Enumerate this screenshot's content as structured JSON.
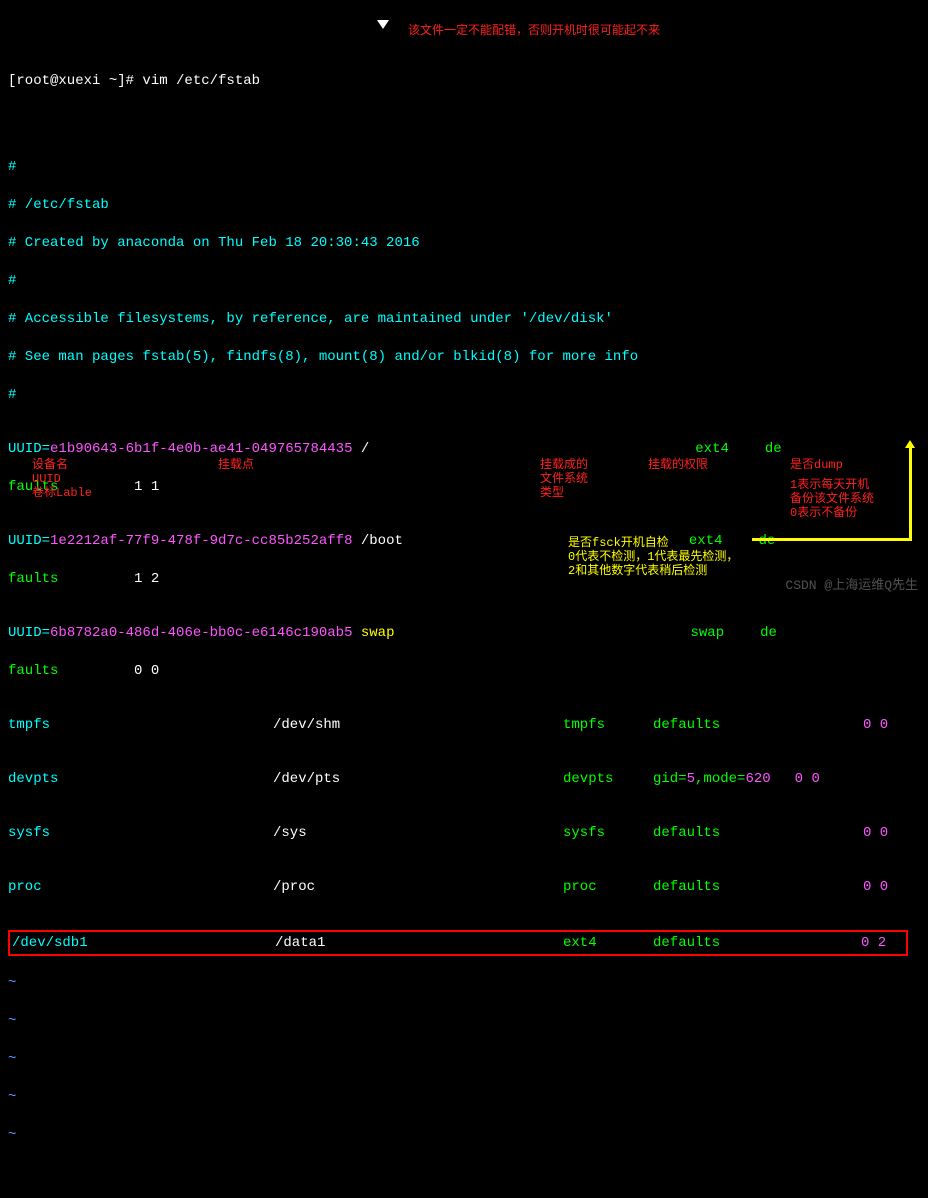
{
  "prompt": {
    "user_host": "[root@xuexi ~]# ",
    "command": "vim /etc/fstab"
  },
  "annot_top": "该文件一定不能配错，否则开机时很可能起不来",
  "comments": {
    "blank0": "#",
    "path": "# /etc/fstab",
    "created": "# Created by anaconda on Thu Feb 18 20:30:43 2016",
    "blank1": "#",
    "access": "# Accessible filesystems, by reference, are maintained under '/dev/disk'",
    "see": "# See man pages fstab(5), findfs(8), mount(8) and/or blkid(8) for more info",
    "blank2": "#"
  },
  "uuid1": {
    "label": "UUID=",
    "id": "e1b90643-6b1f-4e0b-ae41-049765784435",
    "mnt": " /",
    "fs": "ext4",
    "opt": "de",
    "cont": "faults",
    "dump": "         1 1"
  },
  "uuid2": {
    "label": "UUID=",
    "id": "1e2212af-77f9-478f-9d7c-cc85b252aff8",
    "mnt": " /boot",
    "fs": "ext4",
    "opt": "de",
    "cont": "faults",
    "dump": "         1 2"
  },
  "uuid3": {
    "label": "UUID=",
    "id": "6b8782a0-486d-406e-bb0c-e6146c190ab5",
    "mnt": " ",
    "sw": "swap",
    "fs": "swap",
    "opt": "de",
    "cont": "faults",
    "dump": "         0 0"
  },
  "fs": {
    "tmpfs": {
      "dev": "tmpfs",
      "mnt": "/dev/shm",
      "type": "tmpfs",
      "opts": "defaults",
      "dp": "0 0"
    },
    "devpts": {
      "dev": "devpts",
      "mnt": "/dev/pts",
      "type": "devpts",
      "g": "gid=",
      "gn": "5",
      "m": ",mode=",
      "mn": "620",
      "dp": "0 0"
    },
    "sysfs": {
      "dev": "sysfs",
      "mnt": "/sys",
      "type": "sysfs",
      "opts": "defaults",
      "dp": "0 0"
    },
    "proc": {
      "dev": "proc",
      "mnt": "/proc",
      "type": "proc",
      "opts": "defaults",
      "dp": "0 0"
    },
    "sdb1": {
      "dev": "/dev/sdb1",
      "mnt": "/data1",
      "type": "ext4",
      "opts": "defaults",
      "dp": "0 2"
    }
  },
  "labels": {
    "devname": "设备名\nUUID\n卷标Lable",
    "mount": "挂载点",
    "fstype": "挂载成的\n文件系统\n类型",
    "perm": "挂载的权限",
    "dump": "是否dump",
    "dumpdesc": "1表示每天开机\n备份该文件系统\n0表示不备份",
    "fsck": "是否fsck开机自检\n0代表不检测，1代表最先检测，\n2和其他数字代表稍后检测"
  },
  "watermark": "CSDN @上海运维Q先生"
}
